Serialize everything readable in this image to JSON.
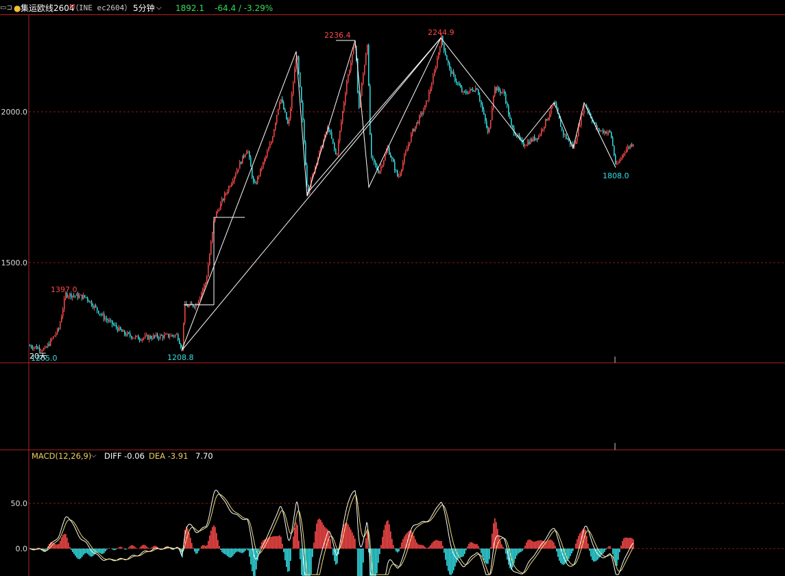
{
  "header": {
    "menu_icon": "menu-icon",
    "dot_color": "#f0c030",
    "name": "集运欧线2604",
    "suffix": "M",
    "code": "（INE ec2604）",
    "period": "5分钟",
    "price": "1892.1",
    "change": "-64.4 / -3.29%"
  },
  "colors": {
    "up": "#ff4a4a",
    "down": "#33e0e6",
    "grid": "#8b1a1a",
    "axis": "#b32424",
    "zigzag": "#ffffff",
    "macd_dif": "#ffffff",
    "macd_dea": "#f0e080"
  },
  "price_axis": {
    "ticks": [
      "2000.0",
      "1500.0"
    ]
  },
  "annotations": {
    "low_left": "1205.0",
    "period_tag": "20天",
    "peak_1397": "1397.0",
    "low_1208": "1208.8",
    "peak_2236": "2236.4",
    "peak_2244": "2244.9",
    "low_1808": "1808.0"
  },
  "macd": {
    "label": "MACD(12,26,9)",
    "diff_label": "DIFF -0.06",
    "dea_label": "DEA -3.91",
    "macd_value": "7.70",
    "ticks": [
      "50.0",
      "0.0"
    ]
  },
  "chart_data": {
    "type": "candlestick",
    "price_levels": [
      1205.0,
      1208.8,
      1397.0,
      1808.0,
      2236.4,
      2244.9
    ],
    "zigzag_points": [
      1208.8,
      2200,
      1720,
      2236.4,
      1750,
      2244.9,
      1900,
      2030,
      1880,
      2030,
      1815
    ],
    "macd": {
      "diff": -0.06,
      "dea": -3.91,
      "macd": 7.7
    }
  }
}
